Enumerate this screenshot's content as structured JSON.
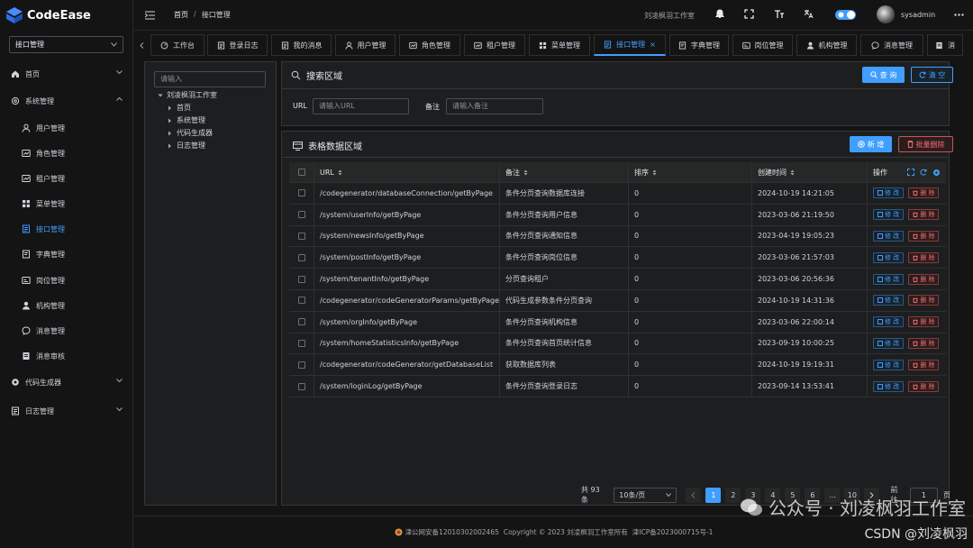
{
  "app": {
    "name": "CodeEase",
    "module": "接口管理"
  },
  "header": {
    "breadcrumb": [
      "首页",
      "接口管理"
    ],
    "studio": "刘凌枫羽工作室",
    "username": "sysadmin"
  },
  "sidebar": {
    "items": [
      {
        "label": "首页",
        "icon": "home-icon",
        "type": "top",
        "chevron": "down"
      },
      {
        "label": "系统管理",
        "icon": "gear-icon",
        "type": "top",
        "chevron": "up"
      },
      {
        "label": "用户管理",
        "icon": "user-icon",
        "type": "sub"
      },
      {
        "label": "角色管理",
        "icon": "role-icon",
        "type": "sub"
      },
      {
        "label": "租户管理",
        "icon": "tenant-icon",
        "type": "sub"
      },
      {
        "label": "菜单管理",
        "icon": "grid-icon",
        "type": "sub"
      },
      {
        "label": "接口管理",
        "icon": "doc-icon",
        "type": "sub",
        "active": true
      },
      {
        "label": "字典管理",
        "icon": "book-icon",
        "type": "sub"
      },
      {
        "label": "岗位管理",
        "icon": "card-icon",
        "type": "sub"
      },
      {
        "label": "机构管理",
        "icon": "person-icon",
        "type": "sub"
      },
      {
        "label": "消息管理",
        "icon": "chat-icon",
        "type": "sub"
      },
      {
        "label": "消息审核",
        "icon": "audit-icon",
        "type": "sub"
      },
      {
        "label": "代码生成器",
        "icon": "cog-icon",
        "type": "top",
        "chevron": "down"
      },
      {
        "label": "日志管理",
        "icon": "log-icon",
        "type": "top",
        "chevron": "down"
      }
    ]
  },
  "tabs": [
    {
      "label": "工作台",
      "icon": "dashboard-icon"
    },
    {
      "label": "登录日志",
      "icon": "doc-icon"
    },
    {
      "label": "我的消息",
      "icon": "doc-icon"
    },
    {
      "label": "用户管理",
      "icon": "user-icon"
    },
    {
      "label": "角色管理",
      "icon": "role-icon"
    },
    {
      "label": "租户管理",
      "icon": "tenant-icon"
    },
    {
      "label": "菜单管理",
      "icon": "grid-icon"
    },
    {
      "label": "接口管理",
      "icon": "doc-icon",
      "active": true
    },
    {
      "label": "字典管理",
      "icon": "book-icon"
    },
    {
      "label": "岗位管理",
      "icon": "card-icon"
    },
    {
      "label": "机构管理",
      "icon": "person-icon"
    },
    {
      "label": "消息管理",
      "icon": "chat-icon"
    },
    {
      "label": "消",
      "icon": "audit-icon"
    }
  ],
  "tree": {
    "placeholder": "请输入",
    "root": "刘凌枫羽工作室",
    "children": [
      "首页",
      "系统管理",
      "代码生成器",
      "日志管理"
    ]
  },
  "search": {
    "title": "搜索区域",
    "query_label": "查 询",
    "clear_label": "清 空",
    "url_label": "URL",
    "url_placeholder": "请输入URL",
    "remark_label": "备注",
    "remark_placeholder": "请输入备注"
  },
  "table": {
    "title": "表格数据区域",
    "add_label": "新 增",
    "batch_delete_label": "批量删除",
    "columns": [
      "URL",
      "备注",
      "排序",
      "创建时间",
      "操作"
    ],
    "edit_label": "修 改",
    "delete_label": "删 除",
    "rows": [
      {
        "url": "/codegenerator/databaseConnection/getByPage",
        "remark": "条件分页查询数据库连接",
        "sort": "0",
        "created": "2024-10-19 14:21:05"
      },
      {
        "url": "/system/userInfo/getByPage",
        "remark": "条件分页查询用户信息",
        "sort": "0",
        "created": "2023-03-06 21:19:50"
      },
      {
        "url": "/system/newsInfo/getByPage",
        "remark": "条件分页查询通知信息",
        "sort": "0",
        "created": "2023-04-19 19:05:23"
      },
      {
        "url": "/system/postInfo/getByPage",
        "remark": "条件分页查询岗位信息",
        "sort": "0",
        "created": "2023-03-06 21:57:03"
      },
      {
        "url": "/system/tenantInfo/getByPage",
        "remark": "分页查询租户",
        "sort": "0",
        "created": "2023-03-06 20:56:36"
      },
      {
        "url": "/codegenerator/codeGeneratorParams/getByPage",
        "remark": "代码生成参数条件分页查询",
        "sort": "0",
        "created": "2024-10-19 14:31:36"
      },
      {
        "url": "/system/orgInfo/getByPage",
        "remark": "条件分页查询机构信息",
        "sort": "0",
        "created": "2023-03-06 22:00:14"
      },
      {
        "url": "/system/homeStatisticsInfo/getByPage",
        "remark": "条件分页查询首页统计信息",
        "sort": "0",
        "created": "2023-09-19 10:00:25"
      },
      {
        "url": "/codegenerator/codeGenerator/getDatabaseList",
        "remark": "获取数据库列表",
        "sort": "0",
        "created": "2024-10-19 19:19:31"
      },
      {
        "url": "/system/loginLog/getByPage",
        "remark": "条件分页查询登录日志",
        "sort": "0",
        "created": "2023-09-14 13:53:41"
      }
    ]
  },
  "pagination": {
    "total": "共 93 条",
    "page_size": "10条/页",
    "pages": [
      "1",
      "2",
      "3",
      "4",
      "5",
      "6",
      "...",
      "10"
    ],
    "current": "1",
    "goto_label": "前往",
    "goto_value": "1",
    "page_unit": "页"
  },
  "footer": {
    "police": "津公网安备12010302002465",
    "copyright": "Copyright © 2023 刘凌枫羽工作室所有",
    "icp": "津ICP备2023000715号-1"
  },
  "watermark": {
    "text": "公众号 · 刘凌枫羽工作室",
    "csdn": "CSDN @刘凌枫羽"
  },
  "colors": {
    "accent": "#409eff",
    "danger": "#f56c6c",
    "bg": "#141414",
    "panel": "#1d1e1f"
  }
}
